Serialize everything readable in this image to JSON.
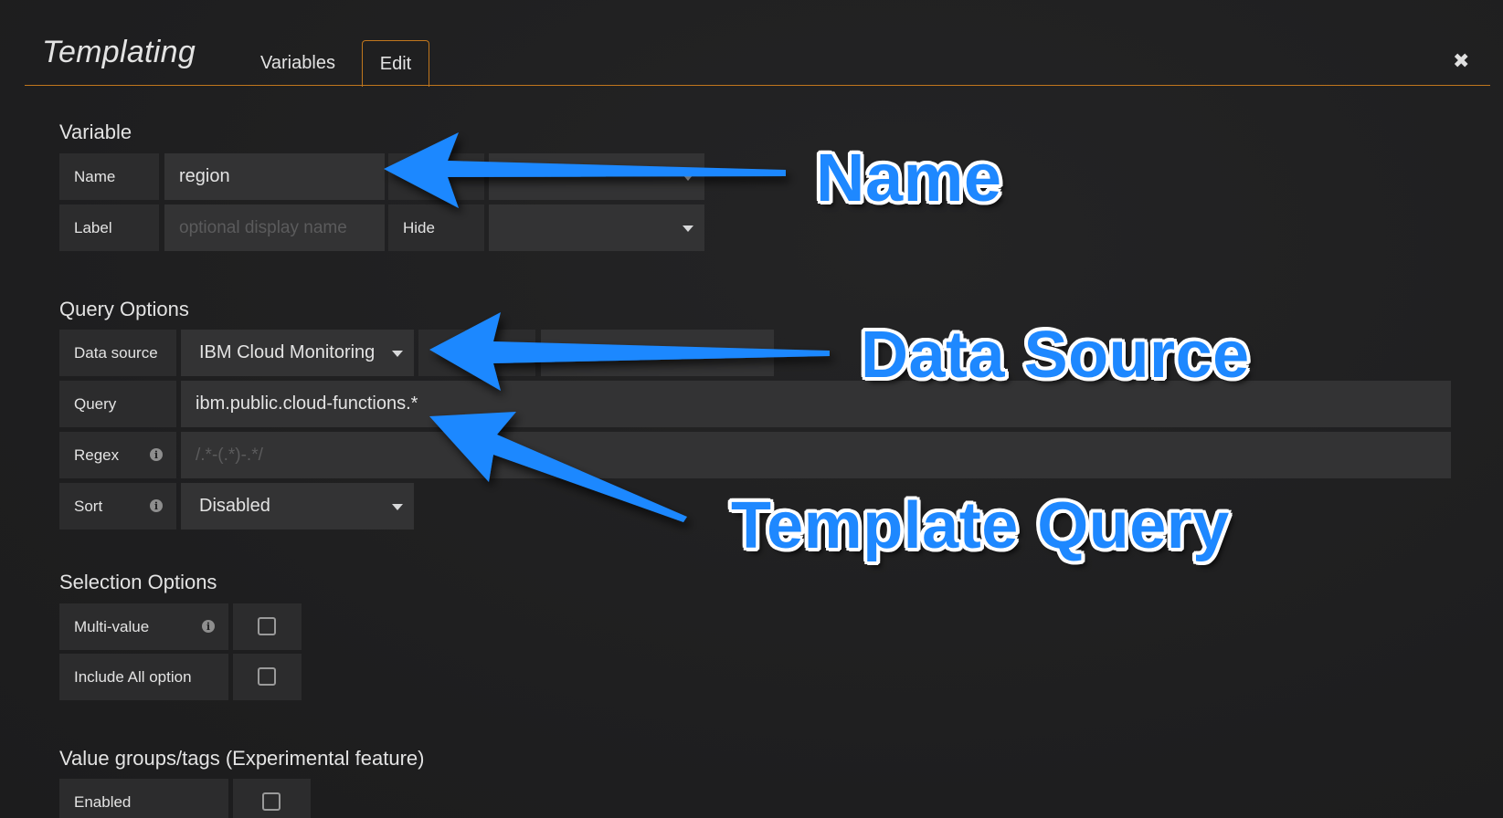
{
  "header": {
    "title": "Templating",
    "tabs": [
      {
        "label": "Variables"
      },
      {
        "label": "Edit"
      }
    ],
    "close_icon": "close-icon"
  },
  "variable": {
    "section_title": "Variable",
    "name_label": "Name",
    "name_value": "region",
    "label_label": "Label",
    "label_placeholder": "optional display name",
    "hide_label": "Hide",
    "hide_value": ""
  },
  "query_options": {
    "section_title": "Query Options",
    "datasource_label": "Data source",
    "datasource_value": "IBM Cloud Monitoring",
    "query_label": "Query",
    "query_value": "ibm.public.cloud-functions.*",
    "regex_label": "Regex",
    "regex_placeholder": "/.*-(.*)-.*/",
    "sort_label": "Sort",
    "sort_value": "Disabled"
  },
  "selection_options": {
    "section_title": "Selection Options",
    "multi_value_label": "Multi-value",
    "multi_value_checked": false,
    "include_all_label": "Include All option",
    "include_all_checked": false
  },
  "value_groups": {
    "section_title": "Value groups/tags (Experimental feature)",
    "enabled_label": "Enabled",
    "enabled_checked": false
  },
  "annotations": {
    "name": "Name",
    "data_source": "Data Source",
    "template_query": "Template Query",
    "arrow_color": "#1e88ff"
  },
  "colors": {
    "accent": "#c0761d",
    "background": "#1f1f20",
    "field": "#333334",
    "label": "#2c2c2d"
  }
}
